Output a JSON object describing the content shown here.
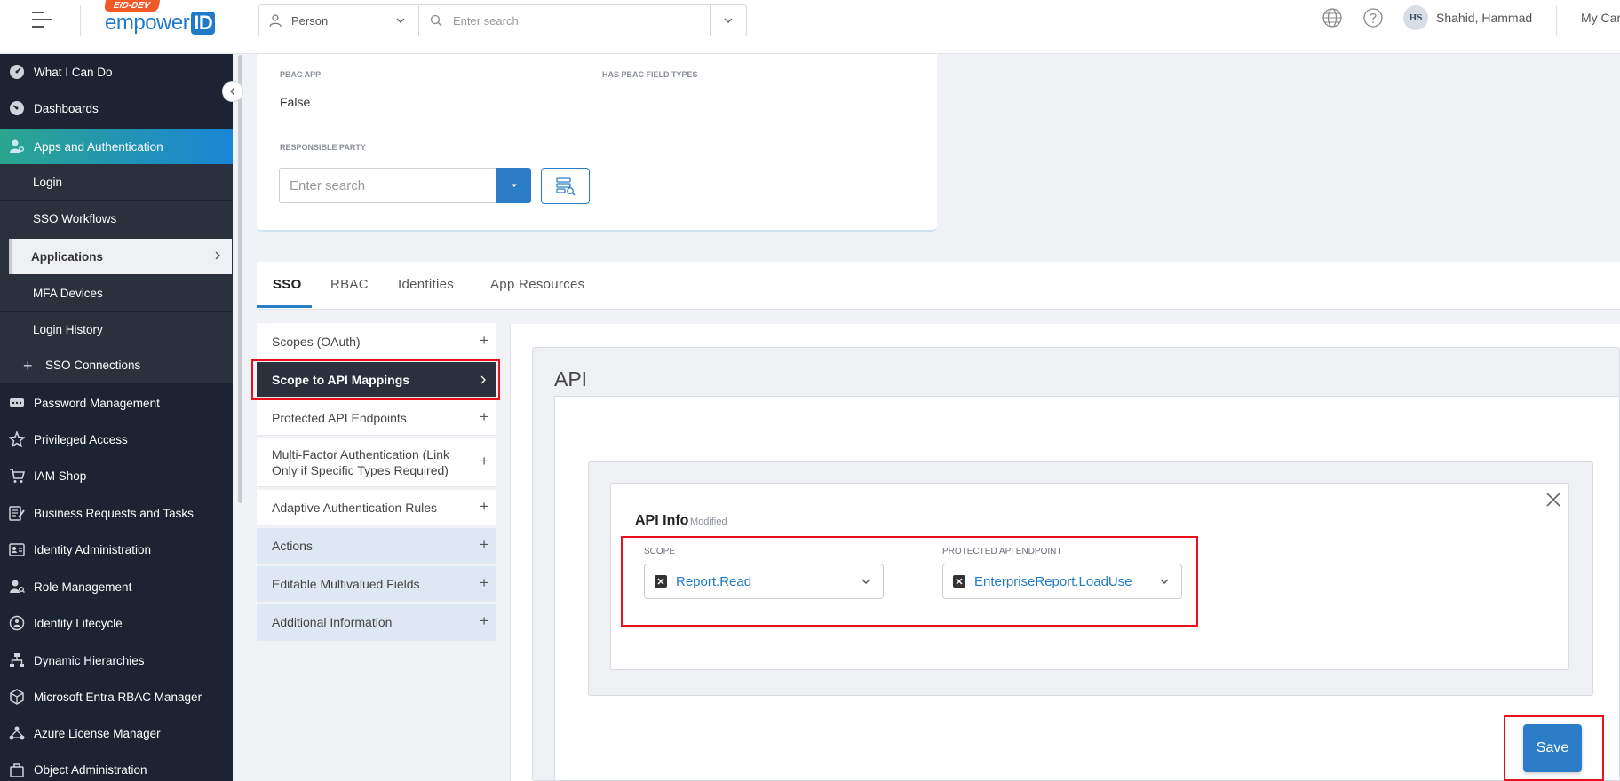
{
  "topbar": {
    "logo_badge": "EID-DEV",
    "logo_text": "empower",
    "logo_id": "ID",
    "search_type": "Person",
    "search_placeholder": "Enter search",
    "user_initials": "HS",
    "user_name": "Shahid, Hammad",
    "my_cart": "My Car"
  },
  "sidebar": {
    "items": [
      {
        "label": "What I Can Do"
      },
      {
        "label": "Dashboards"
      },
      {
        "label": "Apps and Authentication"
      },
      {
        "label": "Password Management"
      },
      {
        "label": "Privileged Access"
      },
      {
        "label": "IAM Shop"
      },
      {
        "label": "Business Requests and Tasks"
      },
      {
        "label": "Identity Administration"
      },
      {
        "label": "Role Management"
      },
      {
        "label": "Identity Lifecycle"
      },
      {
        "label": "Dynamic Hierarchies"
      },
      {
        "label": "Microsoft Entra RBAC Manager"
      },
      {
        "label": "Azure License Manager"
      },
      {
        "label": "Object Administration"
      }
    ],
    "sub_items": [
      {
        "label": "Login"
      },
      {
        "label": "SSO Workflows"
      },
      {
        "label": "Applications"
      },
      {
        "label": "MFA Devices"
      },
      {
        "label": "Login History"
      },
      {
        "label": "SSO Connections"
      }
    ]
  },
  "top_card": {
    "pbac_app_label": "PBAC APP",
    "pbac_app_value": "False",
    "has_pbac_label": "HAS PBAC FIELD TYPES",
    "responsible_label": "RESPONSIBLE PARTY",
    "responsible_placeholder": "Enter search"
  },
  "tabs": [
    {
      "label": "SSO"
    },
    {
      "label": "RBAC"
    },
    {
      "label": "Identities"
    },
    {
      "label": "App Resources"
    }
  ],
  "panel": {
    "items": [
      {
        "label": "Scopes (OAuth)"
      },
      {
        "label": "Scope to API Mappings"
      },
      {
        "label": "Protected API Endpoints"
      },
      {
        "label": "Multi-Factor Authentication (Link Only if Specific Types Required)"
      },
      {
        "label": "Adaptive Authentication Rules"
      },
      {
        "label": "Actions"
      },
      {
        "label": "Editable Multivalued Fields"
      },
      {
        "label": "Additional Information"
      }
    ]
  },
  "api": {
    "title": "API",
    "info_title": "API Info",
    "info_modified": "Modified",
    "scope_label": "SCOPE",
    "scope_value": "Report.Read",
    "endpoint_label": "PROTECTED API ENDPOINT",
    "endpoint_value": "EnterpriseReport.LoadUse",
    "save_label": "Save"
  },
  "colors": {
    "accent": "#2b7dc7",
    "sidebar_bg": "#1c2433",
    "highlight_red": "#e8111b"
  }
}
